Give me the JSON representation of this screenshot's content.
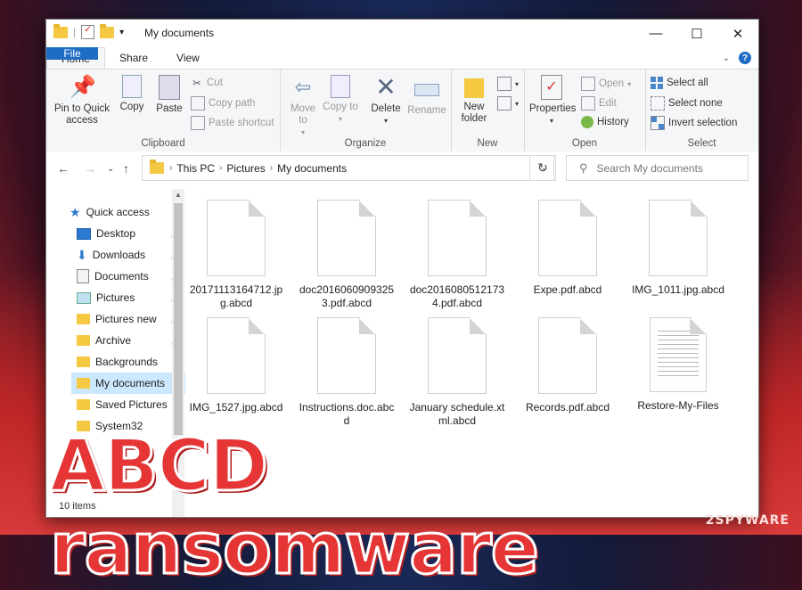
{
  "window": {
    "title": "My documents",
    "controls": [
      "—",
      "☐",
      "✕"
    ]
  },
  "ribbon_tabs": {
    "file": "File",
    "home": "Home",
    "share": "Share",
    "view": "View"
  },
  "ribbon": {
    "clipboard": {
      "label": "Clipboard",
      "pin": "Pin to Quick access",
      "copy": "Copy",
      "paste": "Paste",
      "cut": "Cut",
      "copy_path": "Copy path",
      "paste_shortcut": "Paste shortcut"
    },
    "organize": {
      "label": "Organize",
      "move_to": "Move to",
      "copy_to": "Copy to",
      "delete": "Delete",
      "rename": "Rename"
    },
    "new": {
      "label": "New",
      "new_folder": "New folder"
    },
    "open": {
      "label": "Open",
      "properties": "Properties",
      "open": "Open",
      "edit": "Edit",
      "history": "History"
    },
    "select": {
      "label": "Select",
      "select_all": "Select all",
      "select_none": "Select none",
      "invert": "Invert selection"
    }
  },
  "address": {
    "segments": [
      "This PC",
      "Pictures",
      "My documents"
    ],
    "search_placeholder": "Search My documents"
  },
  "nav": {
    "quick_access": "Quick access",
    "items": [
      {
        "label": "Desktop",
        "icon": "desktop-icon",
        "pinned": true
      },
      {
        "label": "Downloads",
        "icon": "download-icon",
        "pinned": true
      },
      {
        "label": "Documents",
        "icon": "documents-icon",
        "pinned": true
      },
      {
        "label": "Pictures",
        "icon": "pictures-icon",
        "pinned": true
      },
      {
        "label": "Pictures new",
        "icon": "folder-icon",
        "pinned": true
      },
      {
        "label": "Archive",
        "icon": "folder-icon",
        "pinned": true
      },
      {
        "label": "Backgrounds",
        "icon": "folder-icon",
        "pinned": false
      },
      {
        "label": "My documents",
        "icon": "folder-icon",
        "pinned": false,
        "selected": true
      },
      {
        "label": "Saved Pictures",
        "icon": "folder-icon",
        "pinned": false
      },
      {
        "label": "System32",
        "icon": "folder-icon",
        "pinned": false
      }
    ]
  },
  "files": [
    {
      "name": "20171113164712.jpg.abcd"
    },
    {
      "name": "doc20160609093253.pdf.abcd"
    },
    {
      "name": "doc20160805121734.pdf.abcd"
    },
    {
      "name": "Expe.pdf.abcd"
    },
    {
      "name": "IMG_1011.jpg.abcd"
    },
    {
      "name": "IMG_1527.jpg.abcd"
    },
    {
      "name": "Instructions.doc.abcd"
    },
    {
      "name": "January schedule.xtml.abcd"
    },
    {
      "name": "Records.pdf.abcd"
    },
    {
      "name": "Restore-My-Files"
    }
  ],
  "status": {
    "item_count": "10 items"
  },
  "overlay": {
    "headline": "ABCD ransomware",
    "brand": "2SPYWARE"
  },
  "colors": {
    "accent": "#1e6dc4",
    "selection": "#cce8ff",
    "headline": "#e53535"
  }
}
